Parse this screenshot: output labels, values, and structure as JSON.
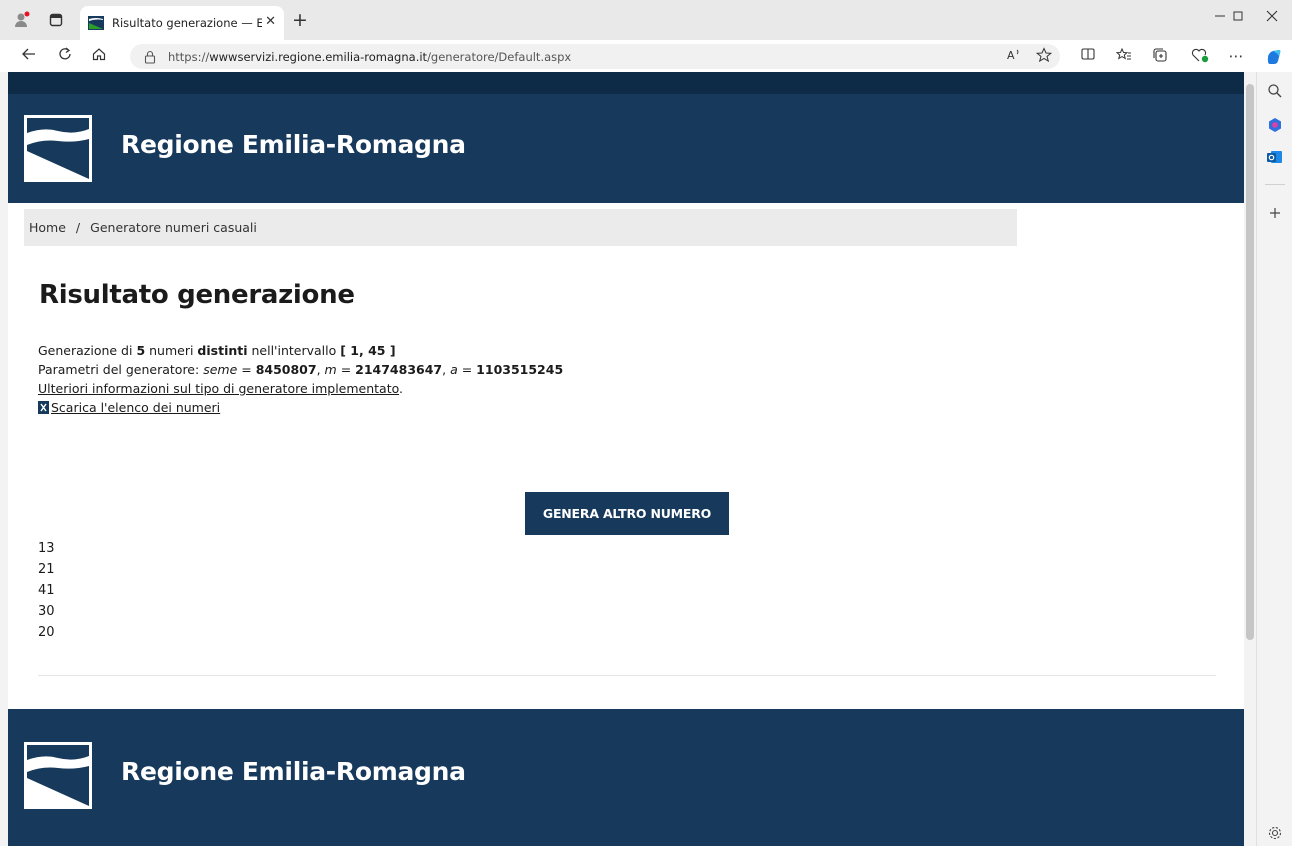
{
  "browser": {
    "tab_title": "Risultato generazione — E-R Il p",
    "tab_close": "✕",
    "new_tab": "+",
    "url_prefix": "https://",
    "url_host": "wwwservizi.regione.emilia-romagna.it",
    "url_path": "/generatore/Default.aspx",
    "more": "⋯"
  },
  "site": {
    "brand": "Regione Emilia-Romagna",
    "brand_color": "#16395c"
  },
  "breadcrumb": {
    "home": "Home",
    "separator": "/",
    "current": "Generatore numeri casuali"
  },
  "page": {
    "title": "Risultato generazione",
    "gen_prefix": "Generazione di ",
    "gen_count": "5",
    "gen_mid": " numeri ",
    "gen_distinct": "distinti",
    "gen_interval_label": " nell'intervallo ",
    "gen_interval": "[ 1, 45 ]",
    "params_label": "Parametri del generatore: ",
    "seed_label": "seme",
    "eq": " = ",
    "seed_value": "8450807",
    "m_label": "m",
    "m_value": "2147483647",
    "a_label": "a",
    "a_value": "1103515245",
    "comma": ", ",
    "info_link": "Ulteriori informazioni sul tipo di generatore implementato",
    "info_dot": ".",
    "download_link": "Scarica l'elenco dei numeri",
    "generate_button": "GENERA ALTRO NUMERO",
    "numbers": [
      "13",
      "21",
      "41",
      "30",
      "20"
    ]
  }
}
